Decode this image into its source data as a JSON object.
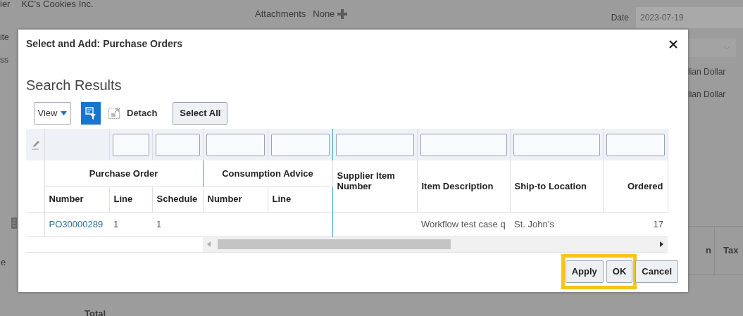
{
  "background": {
    "customer_label": "ier",
    "customer": "KC's Cookies Inc.",
    "attachments_label": "Attachments",
    "attachments_value": "None",
    "date_label": "Date",
    "date_value": "2023-07-19",
    "left_labels": [
      "ite",
      "ss"
    ],
    "currency_values": [
      "lian Dollar",
      "lian Dollar"
    ],
    "left_cut_label": "e",
    "table_headers": [
      "n",
      "Tax"
    ],
    "total_label": "Total"
  },
  "dialog": {
    "title": "Select and Add: Purchase Orders",
    "section_title": "Search Results",
    "toolbar": {
      "view": "View",
      "detach": "Detach",
      "select_all": "Select All"
    },
    "table": {
      "column_groups": [
        {
          "label": "Purchase Order"
        },
        {
          "label": "Consumption Advice"
        }
      ],
      "columns": [
        {
          "label": "Number",
          "filter": false,
          "kind": "text"
        },
        {
          "label": "Line",
          "filter": true,
          "kind": "text"
        },
        {
          "label": "Schedule",
          "filter": true,
          "kind": "text"
        },
        {
          "label": "Number",
          "filter": true,
          "kind": "text"
        },
        {
          "label": "Line",
          "filter": true,
          "kind": "text"
        },
        {
          "label": "Supplier Item Number",
          "filter": true,
          "kind": "text"
        },
        {
          "label": "Item Description",
          "filter": true,
          "kind": "text"
        },
        {
          "label": "Ship-to Location",
          "filter": true,
          "kind": "text"
        },
        {
          "label": "Ordered",
          "filter": true,
          "kind": "number"
        }
      ],
      "rows": [
        {
          "cells": [
            {
              "text": "PO30000289",
              "kind": "link"
            },
            {
              "text": "1",
              "kind": "text"
            },
            {
              "text": "1",
              "kind": "text"
            },
            "",
            "",
            "",
            {
              "text": "Workflow test case q",
              "kind": "text"
            },
            {
              "text": "St. John's",
              "kind": "text"
            },
            {
              "text": "17",
              "kind": "number"
            }
          ]
        }
      ]
    },
    "buttons": [
      {
        "label": "Apply",
        "highlighted": true
      },
      {
        "label": "OK",
        "highlighted": true
      },
      {
        "label": "Cancel",
        "highlighted": false
      }
    ]
  }
}
